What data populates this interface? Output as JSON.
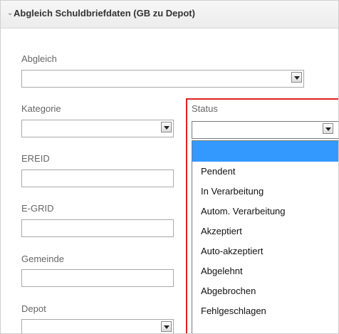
{
  "panel": {
    "title": "Abgleich Schuldbriefdaten (GB zu Depot)"
  },
  "fields": {
    "abgleich": {
      "label": "Abgleich",
      "value": ""
    },
    "kategorie": {
      "label": "Kategorie",
      "value": ""
    },
    "status": {
      "label": "Status",
      "value": ""
    },
    "ereid": {
      "label": "EREID",
      "value": ""
    },
    "egrid": {
      "label": "E-GRID",
      "value": ""
    },
    "gemeinde": {
      "label": "Gemeinde",
      "value": ""
    },
    "depot": {
      "label": "Depot",
      "value": ""
    }
  },
  "status_options": [
    "",
    "Pendent",
    "In Verarbeitung",
    "Autom. Verarbeitung",
    "Akzeptiert",
    "Auto-akzeptiert",
    "Abgelehnt",
    "Abgebrochen",
    "Fehlgeschlagen"
  ],
  "colors": {
    "highlight": "#e02020",
    "selected_option": "#3399ff"
  },
  "icons": {
    "collapse": "chevron-down-icon",
    "dropdown": "dropdown-arrow-icon"
  }
}
